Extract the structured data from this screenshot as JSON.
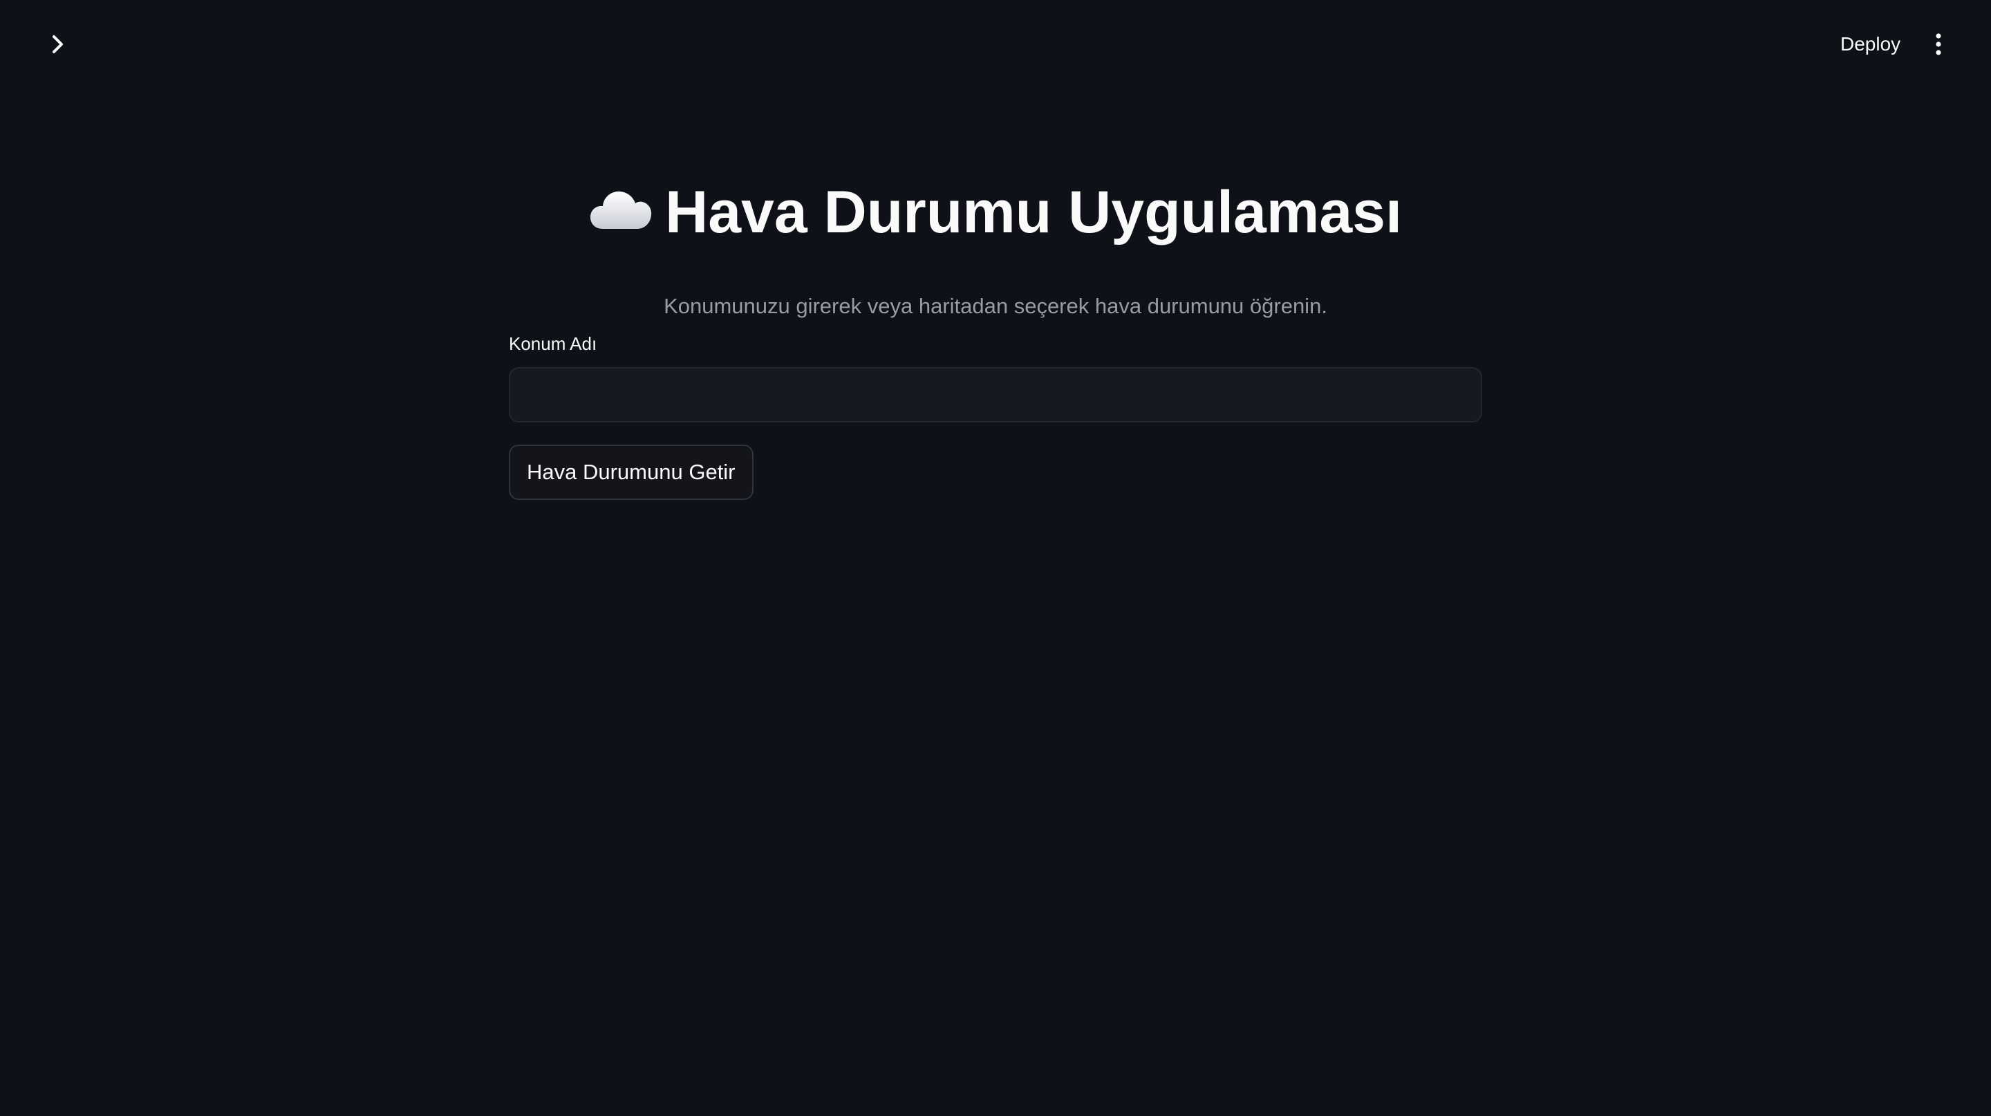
{
  "header": {
    "deploy_label": "Deploy",
    "sidebar_toggle_icon": "chevron-right-icon",
    "menu_icon": "kebab-menu-icon"
  },
  "main": {
    "title_icon": "cloud-icon",
    "title": "Hava Durumu Uygulaması",
    "subtitle": "Konumunuzu girerek veya haritadan seçerek hava durumunu öğrenin.",
    "location_field": {
      "label": "Konum Adı",
      "value": "",
      "placeholder": ""
    },
    "fetch_button_label": "Hava Durumunu Getir"
  },
  "colors": {
    "background": "#0e1117",
    "text": "#fafafa",
    "muted_text": "#9a9ca3",
    "input_background": "#171920"
  }
}
